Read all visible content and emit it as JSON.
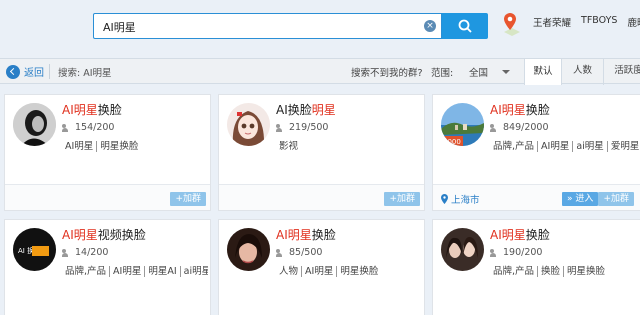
{
  "search": {
    "query": "AI明星"
  },
  "hot_tags": [
    "王者荣耀",
    "TFBOYS",
    "鹿晗"
  ],
  "filter_bar": {
    "back_label": "返回",
    "search_crumb": "搜索: AI明星",
    "not_found": "搜索不到我的群?",
    "scope_label": "范围:",
    "scope_value": "全国",
    "sort_tabs": [
      "默认",
      "人数",
      "活跃度"
    ]
  },
  "cards": [
    {
      "title_hl": "AI明星",
      "title_rest": "换脸",
      "members": "154/200",
      "tags": [
        "AI明星",
        "明星换脸"
      ],
      "action": "+加群",
      "avatar": "bw-portrait"
    },
    {
      "title_pre": "AI换脸",
      "title_hl": "明星",
      "members": "219/500",
      "tags": [
        "影视"
      ],
      "action": "+加群",
      "avatar": "anime-girl"
    },
    {
      "title_hl": "AI明星",
      "title_rest": "换脸",
      "members": "849/2000",
      "tags": [
        "品牌,产品",
        "AI明星",
        "ai明星",
        "爱明星"
      ],
      "city": "上海市",
      "enter": "» 进入",
      "action": "+加群",
      "badge": "2000",
      "avatar": "coast"
    },
    {
      "title_hl": "AI明星",
      "title_rest": "视频换脸",
      "members": "14/200",
      "tags": [
        "品牌,产品",
        "AI明星",
        "明星AI",
        "ai明星"
      ],
      "avatar": "logo-dark",
      "logo_text": "AI 换脸"
    },
    {
      "title_hl": "AI明星",
      "title_rest": "换脸",
      "members": "85/500",
      "tags": [
        "人物",
        "AI明星",
        "明星换脸"
      ],
      "avatar": "woman-1"
    },
    {
      "title_hl": "AI明星",
      "title_rest": "换脸",
      "members": "190/200",
      "tags": [
        "品牌,产品",
        "换脸",
        "明星换脸"
      ],
      "avatar": "woman-2"
    }
  ]
}
